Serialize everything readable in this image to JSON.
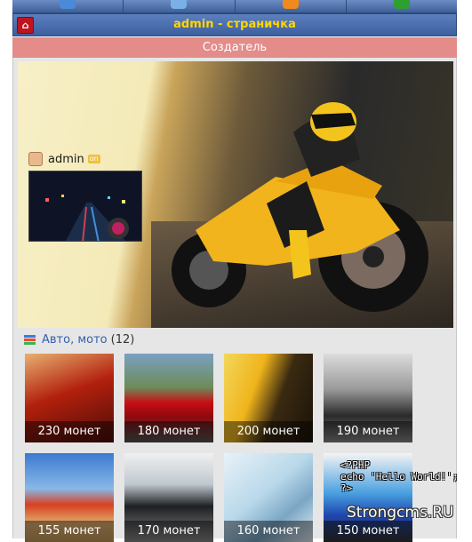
{
  "header": {
    "title": "admin - страничка",
    "role": "Создатель"
  },
  "nav": [
    {
      "icon": "user-icon",
      "color": "#4a8ad8"
    },
    {
      "icon": "mail-icon",
      "color": "#7ab0e8"
    },
    {
      "icon": "rss-icon",
      "color": "#f08a1c"
    },
    {
      "icon": "exit-icon",
      "color": "#2ea030"
    }
  ],
  "profile": {
    "username": "admin",
    "status_badge": "on"
  },
  "category": {
    "name": "Авто, мото",
    "count": "(12)"
  },
  "gallery": [
    {
      "caption": "230 монет",
      "color_a": "#b2200d",
      "color_b": "#e8b070"
    },
    {
      "caption": "180 монет",
      "color_a": "#7aa0c0",
      "color_b": "#c80e14"
    },
    {
      "caption": "200 монет",
      "color_a": "#f2d75c",
      "color_b": "#1a1208"
    },
    {
      "caption": "190 монет",
      "color_a": "#dcdcdc",
      "color_b": "#2a2a2a"
    },
    {
      "caption": "155 монет",
      "color_a": "#3c7ad0",
      "color_b": "#e0b070"
    },
    {
      "caption": "170 монет",
      "color_a": "#bfc8cf",
      "color_b": "#1d1f22"
    },
    {
      "caption": "160 монет",
      "color_a": "#b8d8ea",
      "color_b": "#e8f2f8"
    },
    {
      "caption": "150 монет",
      "color_a": "#4aa0e0",
      "color_b": "#1e46b0"
    }
  ],
  "overlay": {
    "php_line1": "<?PHP",
    "php_line2": "echo 'Hello World!';",
    "php_line3": "?>",
    "brand": "Strongcms.RU"
  }
}
